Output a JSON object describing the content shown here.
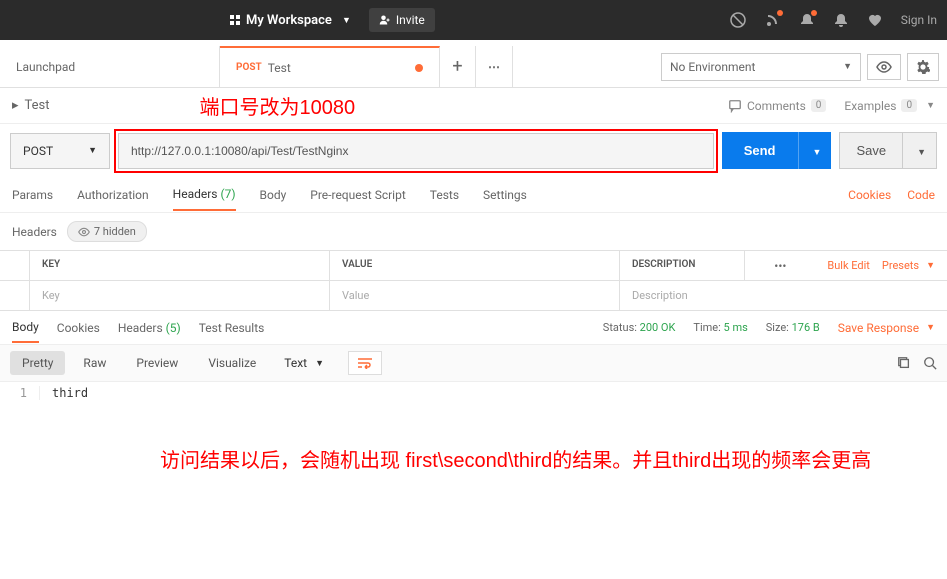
{
  "header": {
    "workspace_label": "My Workspace",
    "invite_label": "Invite",
    "signin_label": "Sign In"
  },
  "tabs": {
    "launchpad": "Launchpad",
    "active_method": "POST",
    "active_name": "Test"
  },
  "environment": {
    "selected": "No Environment"
  },
  "breadcrumb": {
    "name": "Test"
  },
  "annotations": {
    "port_note": "端口号改为10080",
    "result_note": "访问结果以后，会随机出现 first\\second\\third的结果。并且third出现的频率会更高"
  },
  "comments_examples": {
    "comments_label": "Comments",
    "comments_count": "0",
    "examples_label": "Examples",
    "examples_count": "0"
  },
  "request": {
    "method": "POST",
    "url": "http://127.0.0.1:10080/api/Test/TestNginx",
    "send_label": "Send",
    "save_label": "Save"
  },
  "req_tabs": {
    "params": "Params",
    "authorization": "Authorization",
    "headers": "Headers",
    "headers_count": "(7)",
    "body": "Body",
    "prerequest": "Pre-request Script",
    "tests": "Tests",
    "settings": "Settings",
    "cookies_link": "Cookies",
    "code_link": "Code"
  },
  "headers_section": {
    "label": "Headers",
    "hidden_label": "7 hidden"
  },
  "kv": {
    "key_header": "KEY",
    "value_header": "VALUE",
    "description_header": "DESCRIPTION",
    "bulk_edit": "Bulk Edit",
    "presets": "Presets",
    "key_placeholder": "Key",
    "value_placeholder": "Value",
    "description_placeholder": "Description"
  },
  "response_tabs": {
    "body": "Body",
    "cookies": "Cookies",
    "headers": "Headers",
    "headers_count": "(5)",
    "test_results": "Test Results"
  },
  "response_info": {
    "status_label": "Status:",
    "status_value": "200 OK",
    "time_label": "Time:",
    "time_value": "5 ms",
    "size_label": "Size:",
    "size_value": "176 B",
    "save_response": "Save Response"
  },
  "response_toolbar": {
    "pretty": "Pretty",
    "raw": "Raw",
    "preview": "Preview",
    "visualize": "Visualize",
    "format": "Text"
  },
  "response_body": {
    "line_num": "1",
    "content": "third"
  }
}
